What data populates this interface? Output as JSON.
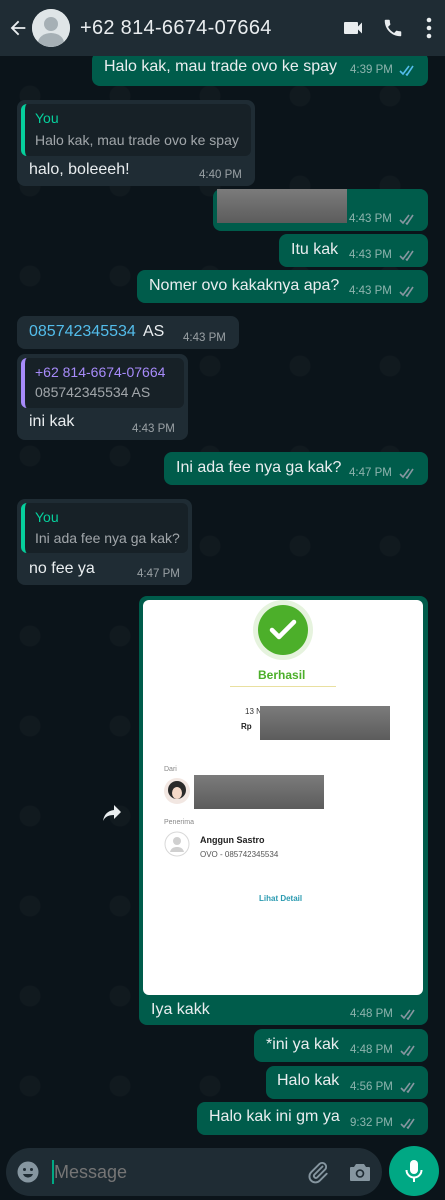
{
  "header": {
    "contact": "+62 814-6674-07664"
  },
  "messages": {
    "m1": {
      "text": "Halo kak, mau trade ovo ke spay",
      "time": "4:39 PM"
    },
    "m2": {
      "quote_name": "You",
      "quote_text": "Halo kak, mau trade ovo ke spay",
      "text": "halo, boleeeh!",
      "time": "4:40 PM"
    },
    "m3": {
      "time": "4:43 PM"
    },
    "m4": {
      "text": "Itu kak",
      "time": "4:43 PM"
    },
    "m5": {
      "text": "Nomer ovo kakaknya apa?",
      "time": "4:43 PM"
    },
    "m6": {
      "link": "085742345534",
      "suffix": " AS",
      "time": "4:43 PM"
    },
    "m7": {
      "quote_name": "+62 814-6674-07664",
      "quote_text": "085742345534 AS",
      "text": "ini kak",
      "time": "4:43 PM"
    },
    "m8": {
      "text": "Ini ada fee nya ga kak?",
      "time": "4:47 PM"
    },
    "m9": {
      "quote_name": "You",
      "quote_text": "Ini ada fee nya ga kak?",
      "text": "no fee ya",
      "time": "4:47 PM"
    },
    "m10": {
      "receipt": {
        "status": "Berhasil",
        "date_prefix": "13 N",
        "amount_prefix": "Rp",
        "from_label": "Dari",
        "to_label": "Penerima",
        "recipient_name": "Anggun Sastro",
        "recipient_account": "OVO - 085742345534",
        "detail_link": "Lihat Detail"
      },
      "caption": "Iya kakk",
      "time": "4:48 PM"
    },
    "m11": {
      "text": "*ini ya kak",
      "time": "4:48 PM"
    },
    "m12": {
      "text": "Halo kak",
      "time": "4:56 PM"
    },
    "m13": {
      "text": "Halo kak ini gm ya",
      "time": "9:32 PM"
    }
  },
  "input": {
    "placeholder": "Message"
  },
  "colors": {
    "header_bg": "#1f2c34",
    "chat_bg": "#0b141a",
    "outgoing_bubble": "#005c4b",
    "incoming_bubble": "#1f2c34",
    "accent": "#00a884",
    "read_ticks": "#53bdeb",
    "success_green": "#4caf2a",
    "link_blue": "#53bdeb"
  },
  "icons": [
    "back-arrow-icon",
    "default-avatar-icon",
    "video-call-icon",
    "phone-icon",
    "more-vert-icon",
    "forward-icon",
    "emoji-icon",
    "attach-icon",
    "camera-icon",
    "mic-icon",
    "checkmark-icon"
  ]
}
